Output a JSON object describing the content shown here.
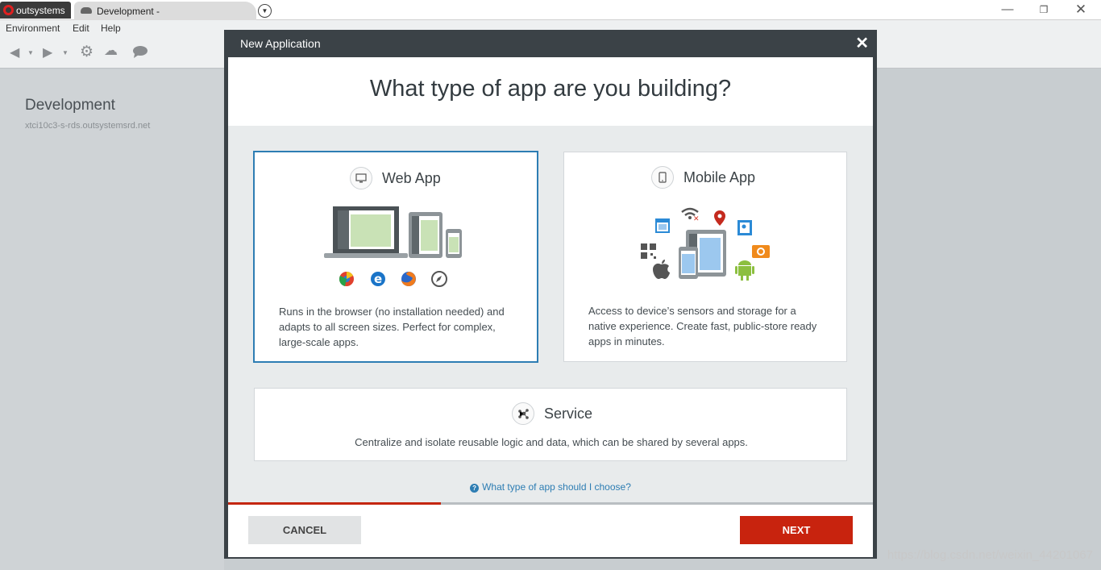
{
  "titlebar": {
    "home_tab": "outsystems",
    "env_tab": "Development -"
  },
  "menu": {
    "items": [
      "Environment",
      "Edit",
      "Help"
    ]
  },
  "environment": {
    "name": "Development",
    "host": "xtci10c3-s-rds.outsystemsrd.net"
  },
  "modal": {
    "title": "New Application",
    "heading": "What type of app are you building?",
    "cards": {
      "web": {
        "title": "Web App",
        "description": "Runs in the browser (no installation needed) and adapts to all screen sizes. Perfect for complex, large-scale apps.",
        "selected": true
      },
      "mobile": {
        "title": "Mobile App",
        "description": "Access to device’s sensors and storage for a native experience. Create fast, public-store ready apps in minutes."
      },
      "service": {
        "title": "Service",
        "description": "Centralize and isolate reusable logic and data, which can be shared by several apps."
      }
    },
    "help_link": "What type of app should I choose?",
    "progress": 0.33,
    "cancel_label": "CANCEL",
    "next_label": "NEXT"
  },
  "watermark": "https://blog.csdn.net/weixin_44201067",
  "colors": {
    "accent": "#2d7db3",
    "primary_button": "#c8230e",
    "modal_header": "#3b4247"
  }
}
